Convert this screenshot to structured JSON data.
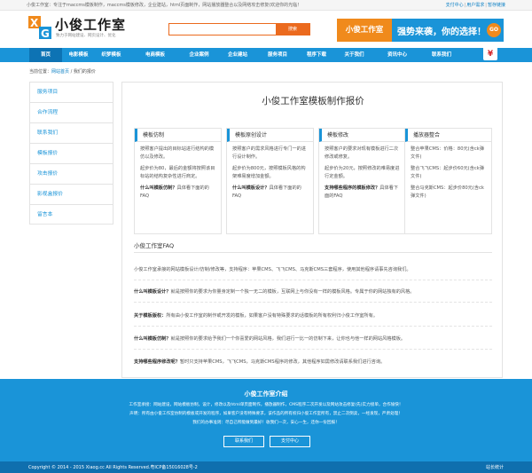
{
  "topbar": {
    "notice": "小俊工作室：专注于maccms模板制作，maccms模板修改，企业建站，html页面制作，网站播放器整合以及网络攻击修复(欢迎你的光临！",
    "links": [
      "支付中心",
      "用户需求",
      "暂存链接"
    ]
  },
  "header": {
    "logo_name": "小俊工作室",
    "logo_slogan": "致力于网站建设、网页设计、优化",
    "search_placeholder": "",
    "search_button": "搜索"
  },
  "banner": {
    "left": "小俊工作室",
    "right": "强势来袭，你的选择！",
    "go": "GO"
  },
  "nav": {
    "items": [
      "首页",
      "电影模板",
      "织梦模板",
      "电商模板",
      "企业案例",
      "企业建站",
      "服务项目",
      "程序下载",
      "关于我们",
      "资讯中心",
      "联系我们"
    ],
    "active_index": 0,
    "badge": "¥"
  },
  "breadcrumb": {
    "prefix": "当前位置：",
    "home": "网站首页",
    "sep": " / ",
    "current": "我们的报价"
  },
  "sidebar": {
    "items": [
      "服务项目",
      "合作流程",
      "联系我们",
      "模板报价",
      "攻击报价",
      "影视盒报价",
      "留言本"
    ]
  },
  "main": {
    "title": "小俊工作室模板制作报价",
    "cards": [
      {
        "title": "模板仿制",
        "paragraphs": [
          "按照客户提出的目标站进行结构的模仿以及修改。",
          "起步价为80，最后的金额将按照该目标站的结构复杂性进行商定。"
        ],
        "q": "什么叫模板仿制？",
        "a": "具体看下面的的FAQ"
      },
      {
        "title": "模板原创设计",
        "paragraphs": [
          "按照客户的需求风格进行专门一的进行设计制作。",
          "起步价为800元，按照模板风格的构架难易度增加金额。"
        ],
        "q": "什么叫模板设计？",
        "a": "具体看下面的的FAQ"
      },
      {
        "title": "模板修改",
        "paragraphs": [
          "按照客户的要求对现有模板进行二次修改或修复。",
          "起步价为20元，按照修改的难易度进行定金额。"
        ],
        "q": "支持哪些程序的模板修改？",
        "a": "具体看下面的FAQ"
      },
      {
        "title": "播放器整合",
        "paragraphs": [
          "整合苹果CMS：价格：80元(含ck弹文件)",
          "整合飞飞CMS：起步价60元(含ck弹文件)",
          "整合马克斯CMS：起步价80元(含ck弹文件)"
        ],
        "q": "",
        "a": ""
      }
    ],
    "faq_title": "小俊工作室FAQ",
    "faq": [
      {
        "q": "",
        "a": "小俊工作室承接的网站模板设计/仿制/修改等，支持程序：苹果CMS、飞飞CMS、马克斯CMS三套程序，使用其他程序请事先咨询我们。"
      },
      {
        "q": "什么叫模板设计？",
        "a": "就是按照你的要求为你量身定制一个独一无二的模板，互联网上与你没有一样的模板风格。专属于你的网站独有的风格。"
      },
      {
        "q": "关于模板版权：",
        "a": "所有由小俊工作室的制作或开发的模板，如果客户没有特殊要求的话模板的所有权利归小俊工作室所有。"
      },
      {
        "q": "什么叫模板仿制？",
        "a": "就是按照你的要求给予我们一个你喜爱的网站风格，我们进行一比一的仿制下来，让你也与他一样的网站风格模板。"
      },
      {
        "q": "支持哪些程序修改呢？",
        "a": "暂时只支持苹果CMS，飞飞CMS，马克斯CMS程序的修改，其他程序如需修改请联系我们进行咨询。"
      }
    ]
  },
  "footer": {
    "title": "小俊工作室介绍",
    "lines": [
      "工作室承接：网站建设，网站模板仿制，设计，修改以及html单页面制作，播放器制作，CMS程序二次开发以及网站攻击修复(先)实力接单，合作愉快！",
      "声明：所有由小俊工作室仿制的模板或开发的程序，如果客户没有特殊要求，该作品的所有权归小俊工作室所有，禁止二次倒卖，一经发现，严肃处理！",
      "我们的办事准则：尽自己所能做到最好！收我们一次，安心一生，还你一份回报！"
    ],
    "buttons": [
      "联系我们",
      "支付中心"
    ]
  },
  "bottombar": {
    "copyright": "Copyright © 2014 - 2015 Xiaog.cc All Rights Reserved.粤ICP备15016028号-2",
    "stat": "站长统计"
  },
  "colors": {
    "primary": "#1a94d8",
    "accent": "#eb6a1e",
    "banner_orange": "#f08a1c",
    "footer_dark": "#0f6fae"
  }
}
